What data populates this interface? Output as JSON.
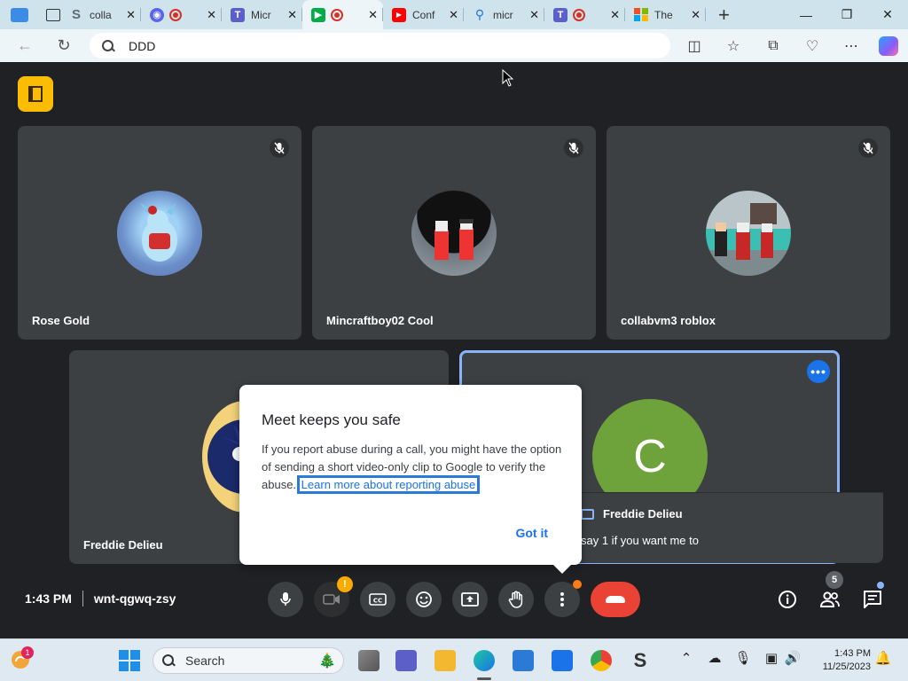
{
  "browser": {
    "tabs": [
      {
        "title": "colla",
        "favicon": "S",
        "color": "#5f6b73"
      },
      {
        "title": "",
        "favicon": "discord",
        "color": "#5865f2",
        "recording": true
      },
      {
        "title": "Micr",
        "favicon": "teams",
        "color": "#5b5fc7"
      },
      {
        "title": "",
        "favicon": "meet",
        "color": "#00ac47",
        "recording": true,
        "active": true
      },
      {
        "title": "Conf",
        "favicon": "youtube",
        "color": "#ff0000"
      },
      {
        "title": "micr",
        "favicon": "search",
        "color": "#1a73e8"
      },
      {
        "title": "",
        "favicon": "teams",
        "color": "#5b5fc7",
        "recording": true
      },
      {
        "title": "The",
        "favicon": "microsoft",
        "color": "#f25022"
      }
    ],
    "address": "DDD"
  },
  "meet": {
    "participants": [
      {
        "name": "Rose Gold"
      },
      {
        "name": "Mincraftboy02 Cool"
      },
      {
        "name": "collabvm3 roblox"
      },
      {
        "name": "Freddie Delieu"
      },
      {
        "name": "C",
        "initial": "C"
      }
    ],
    "chat_preview": {
      "sender": "Freddie Delieu",
      "message": "say 1 if you want me to"
    },
    "dialog": {
      "title": "Meet keeps you safe",
      "body": "If you report abuse during a call, you might have the option of sending a short video-only clip to Google to verify the abuse.",
      "link": "Learn more about reporting abuse",
      "button": "Got it"
    },
    "time": "1:43 PM",
    "meeting_code": "wnt-qgwq-zsy",
    "people_count": "5",
    "camera_badge": "!"
  },
  "taskbar": {
    "search_label": "Search",
    "time": "1:43 PM",
    "date": "11/25/2023",
    "weather_badge": "1"
  }
}
